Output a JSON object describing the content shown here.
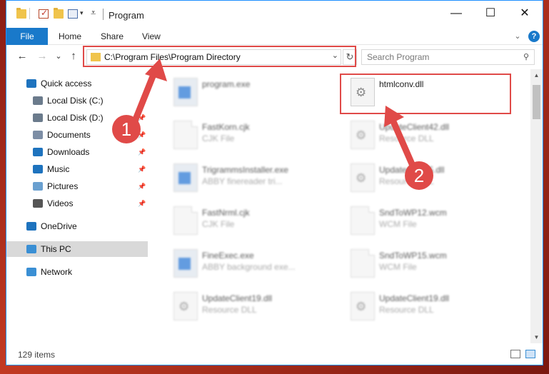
{
  "window": {
    "title": "Program",
    "controls": {
      "minimize": "—",
      "maximize": "☐",
      "close": "✕"
    }
  },
  "ribbon": {
    "tabs": [
      "File",
      "Home",
      "Share",
      "View"
    ],
    "expand_icon": "⌄",
    "help_icon": "?"
  },
  "nav": {
    "back": "←",
    "forward": "→",
    "recent": "⌄",
    "up": "↑",
    "address": "C:\\Program Files\\Program Directory",
    "address_chevron": "⌄",
    "refresh": "↻",
    "search_placeholder": "Search Program",
    "search_icon": "⚲"
  },
  "sidebar": {
    "items": [
      {
        "label": "Quick access",
        "icon": "star-icon",
        "color": "#1e73be",
        "pinned": false,
        "selected": false
      },
      {
        "label": "Local Disk (C:)",
        "icon": "drive-icon",
        "color": "#6b7b8c",
        "pinned": false,
        "selected": false
      },
      {
        "label": "Local Disk (D:)",
        "icon": "drive-icon",
        "color": "#6b7b8c",
        "pinned": true,
        "selected": false
      },
      {
        "label": "Documents",
        "icon": "documents-icon",
        "color": "#7d8ea5",
        "pinned": true,
        "selected": false
      },
      {
        "label": "Downloads",
        "icon": "downloads-icon",
        "color": "#1e73be",
        "pinned": true,
        "selected": false
      },
      {
        "label": "Music",
        "icon": "music-icon",
        "color": "#1e73be",
        "pinned": true,
        "selected": false
      },
      {
        "label": "Pictures",
        "icon": "pictures-icon",
        "color": "#6aa0d0",
        "pinned": true,
        "selected": false
      },
      {
        "label": "Videos",
        "icon": "videos-icon",
        "color": "#555555",
        "pinned": true,
        "selected": false
      },
      {
        "label": "OneDrive",
        "icon": "onedrive-icon",
        "color": "#1e73be",
        "pinned": false,
        "selected": false
      },
      {
        "label": "This PC",
        "icon": "computer-icon",
        "color": "#3a8fd4",
        "pinned": false,
        "selected": true
      },
      {
        "label": "Network",
        "icon": "network-icon",
        "color": "#3a8fd4",
        "pinned": false,
        "selected": false
      }
    ],
    "pin_glyph": "📌"
  },
  "files": [
    {
      "name": "program.exe",
      "type": "",
      "icon": "program-exe-icon",
      "kind": "exe",
      "highlighted": false
    },
    {
      "name": "htmlconv.dll",
      "type": "",
      "icon": "dll-icon",
      "kind": "dll",
      "highlighted": true
    },
    {
      "name": "FastKorn.cjk",
      "type": "CJK File",
      "icon": "file-icon",
      "kind": "doc",
      "highlighted": false
    },
    {
      "name": "UpdateClient42.dll",
      "type": "Resource DLL",
      "icon": "dll-icon",
      "kind": "dll",
      "highlighted": false
    },
    {
      "name": "TrigrammsInstaller.exe",
      "type": "ABBY finereader tri...",
      "icon": "exe-icon",
      "kind": "exe",
      "highlighted": false
    },
    {
      "name": "UpdateClient5.dll",
      "type": "Resource DLL",
      "icon": "dll-icon",
      "kind": "dll",
      "highlighted": false
    },
    {
      "name": "FastNrml.cjk",
      "type": "CJK File",
      "icon": "file-icon",
      "kind": "doc",
      "highlighted": false
    },
    {
      "name": "SndToWP12.wcm",
      "type": "WCM File",
      "icon": "file-icon",
      "kind": "doc",
      "highlighted": false
    },
    {
      "name": "FineExec.exe",
      "type": "ABBY background exe...",
      "icon": "exe-icon",
      "kind": "exe",
      "highlighted": false
    },
    {
      "name": "SndToWP15.wcm",
      "type": "WCM File",
      "icon": "file-icon",
      "kind": "doc",
      "highlighted": false
    },
    {
      "name": "UpdateClient19.dll",
      "type": "Resource DLL",
      "icon": "dll-icon",
      "kind": "dll",
      "highlighted": false
    },
    {
      "name": "UpdateClient19.dll",
      "type": "Resource DLL",
      "icon": "dll-icon",
      "kind": "dll",
      "highlighted": false
    }
  ],
  "status": {
    "count": "129 items"
  },
  "annotations": {
    "marker1": "1",
    "marker2": "2",
    "color": "#e04a48"
  }
}
